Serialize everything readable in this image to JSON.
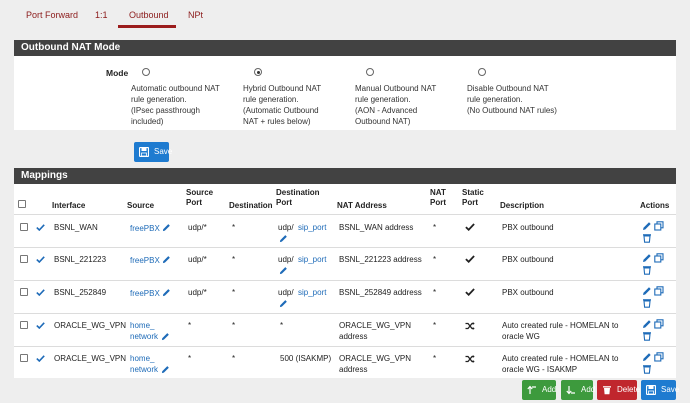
{
  "tabs": [
    {
      "label": "Port Forward"
    },
    {
      "label": "1:1"
    },
    {
      "label": "Outbound"
    },
    {
      "label": "NPt"
    }
  ],
  "active_tab": "Outbound",
  "nat_mode": {
    "title": "Outbound NAT Mode",
    "label": "Mode",
    "selected": "hybrid",
    "options": [
      {
        "id": "automatic",
        "lines": [
          "Automatic outbound NAT",
          "rule generation.",
          "(IPsec passthrough",
          "included)"
        ]
      },
      {
        "id": "hybrid",
        "lines": [
          "Hybrid Outbound NAT",
          "rule generation.",
          "(Automatic Outbound",
          "NAT + rules below)"
        ]
      },
      {
        "id": "manual",
        "lines": [
          "Manual Outbound NAT",
          "rule generation.",
          "(AON - Advanced",
          "Outbound NAT)"
        ]
      },
      {
        "id": "disabled",
        "lines": [
          "Disable Outbound NAT",
          "rule generation.",
          "(No Outbound NAT rules)"
        ]
      }
    ],
    "save_label": "Save"
  },
  "mappings": {
    "title": "Mappings",
    "columns": {
      "interface": "Interface",
      "source": "Source",
      "source_port": [
        "Source",
        "Port"
      ],
      "destination": "Destination",
      "destination_port": [
        "Destination",
        "Port"
      ],
      "nat_address": "NAT Address",
      "nat_port": [
        "NAT",
        "Port"
      ],
      "static_port": [
        "Static",
        "Port"
      ],
      "description": "Description",
      "actions": "Actions"
    },
    "rows": [
      {
        "interface": "BSNL_WAN",
        "source": "freePBX",
        "source_port": "udp/*",
        "destination": "*",
        "dest_proto": "udp/",
        "dest_port": "sip_port",
        "nat_address": [
          "BSNL_WAN address"
        ],
        "nat_port": "*",
        "static_port": "check",
        "description": [
          "PBX outbound"
        ]
      },
      {
        "interface": "BSNL_221223",
        "source": "freePBX",
        "source_port": "udp/*",
        "destination": "*",
        "dest_proto": "udp/",
        "dest_port": "sip_port",
        "nat_address": [
          "BSNL_221223 address"
        ],
        "nat_port": "*",
        "static_port": "check",
        "description": [
          "PBX outbound"
        ]
      },
      {
        "interface": "BSNL_252849",
        "source": "freePBX",
        "source_port": "udp/*",
        "destination": "*",
        "dest_proto": "udp/",
        "dest_port": "sip_port",
        "nat_address": [
          "BSNL_252849 address"
        ],
        "nat_port": "*",
        "static_port": "check",
        "description": [
          "PBX outbound"
        ]
      },
      {
        "interface": "ORACLE_WG_VPN",
        "source": [
          "home_",
          "network"
        ],
        "source_port": "*",
        "destination": "*",
        "dest_text": "*",
        "nat_address": [
          "ORACLE_WG_VPN",
          "address"
        ],
        "nat_port": "*",
        "static_port": "shuffle",
        "description": [
          "Auto created rule - HOMELAN to",
          "oracle WG"
        ]
      },
      {
        "interface": "ORACLE_WG_VPN",
        "source": [
          "home_",
          "network"
        ],
        "source_port": "*",
        "destination": "*",
        "dest_text": "500 (ISAKMP)",
        "nat_address": [
          "ORACLE_WG_VPN",
          "address"
        ],
        "nat_port": "*",
        "static_port": "shuffle",
        "description": [
          "Auto created rule - HOMELAN to",
          "oracle WG - ISAKMP"
        ]
      }
    ]
  },
  "footer_buttons": {
    "add_top": "Add",
    "add_bottom": "Add",
    "delete": "Delete",
    "save": "Save"
  },
  "colors": {
    "accent_red": "#9b1c1c",
    "link_blue": "#1e6bb8",
    "header_dark": "#424242",
    "btn_blue": "#1e7bd0",
    "btn_green": "#3d9a3d",
    "btn_red": "#c0262d"
  }
}
